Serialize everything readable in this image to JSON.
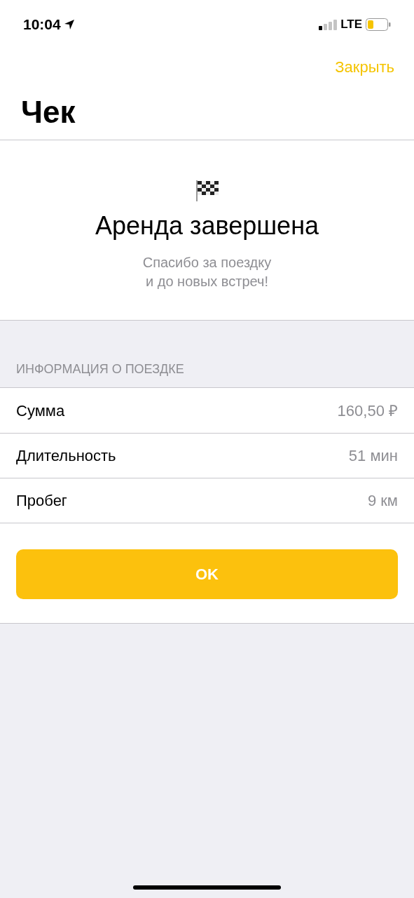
{
  "status_bar": {
    "time": "10:04",
    "network": "LTE"
  },
  "nav": {
    "close": "Закрыть",
    "title": "Чек"
  },
  "summary": {
    "title": "Аренда завершена",
    "subtitle": "Спасибо за поездку\nи до новых встреч!"
  },
  "section": {
    "header": "ИНФОРМАЦИЯ О ПОЕЗДКЕ",
    "rows": [
      {
        "label": "Сумма",
        "value": "160,50 ₽"
      },
      {
        "label": "Длительность",
        "value": "51 мин"
      },
      {
        "label": "Пробег",
        "value": "9 км"
      }
    ]
  },
  "button": "OK"
}
